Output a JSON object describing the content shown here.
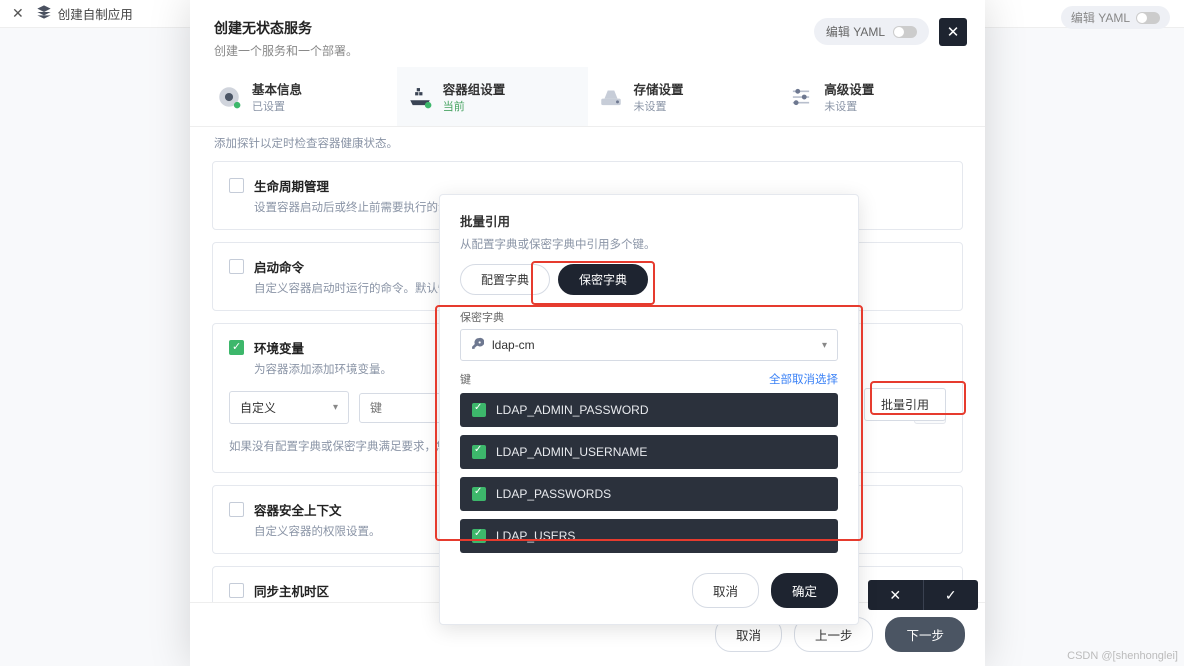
{
  "top": {
    "app_name": "创建自制应用",
    "yaml_label": "编辑 YAML"
  },
  "dialog": {
    "title": "创建无状态服务",
    "subtitle": "创建一个服务和一个部署。",
    "yaml_chip": "编辑 YAML"
  },
  "steps": [
    {
      "title": "基本信息",
      "status": "已设置"
    },
    {
      "title": "容器组设置",
      "status": "当前"
    },
    {
      "title": "存储设置",
      "status": "未设置"
    },
    {
      "title": "高级设置",
      "status": "未设置"
    }
  ],
  "truncated_top": "添加探针以定时检查容器健康状态。",
  "groups": {
    "lifecycle": {
      "title": "生命周期管理",
      "desc": "设置容器启动后或终止前需要执行的动作，以进行环境检查或体面终止。"
    },
    "startcmd": {
      "title": "启动命令",
      "desc": "自定义容器启动时运行的命令。默认情况下"
    },
    "envvar": {
      "title": "环境变量",
      "desc": "为容器添加添加环境变量。",
      "type_value": "自定义",
      "key_placeholder": "键",
      "hint": "如果没有配置字典或保密字典满足要求，您可以",
      "bulk_btn": "批量引用"
    },
    "security": {
      "title": "容器安全上下文",
      "desc": "自定义容器的权限设置。"
    },
    "tz": {
      "title": "同步主机时区",
      "desc": "同步容器与主机的时区。"
    }
  },
  "sub": {
    "title": "批量引用",
    "desc": "从配置字典或保密字典中引用多个键。",
    "seg_config": "配置字典",
    "seg_secret": "保密字典",
    "field_label": "保密字典",
    "select_value": "ldap-cm",
    "keys_label": "键",
    "deselect_all": "全部取消选择",
    "keys": [
      "LDAP_ADMIN_PASSWORD",
      "LDAP_ADMIN_USERNAME",
      "LDAP_PASSWORDS",
      "LDAP_USERS"
    ],
    "cancel": "取消",
    "ok": "确定"
  },
  "footer": {
    "cancel": "取消",
    "prev": "上一步",
    "next": "下一步"
  },
  "watermark": "CSDN @[shenhonglei]"
}
